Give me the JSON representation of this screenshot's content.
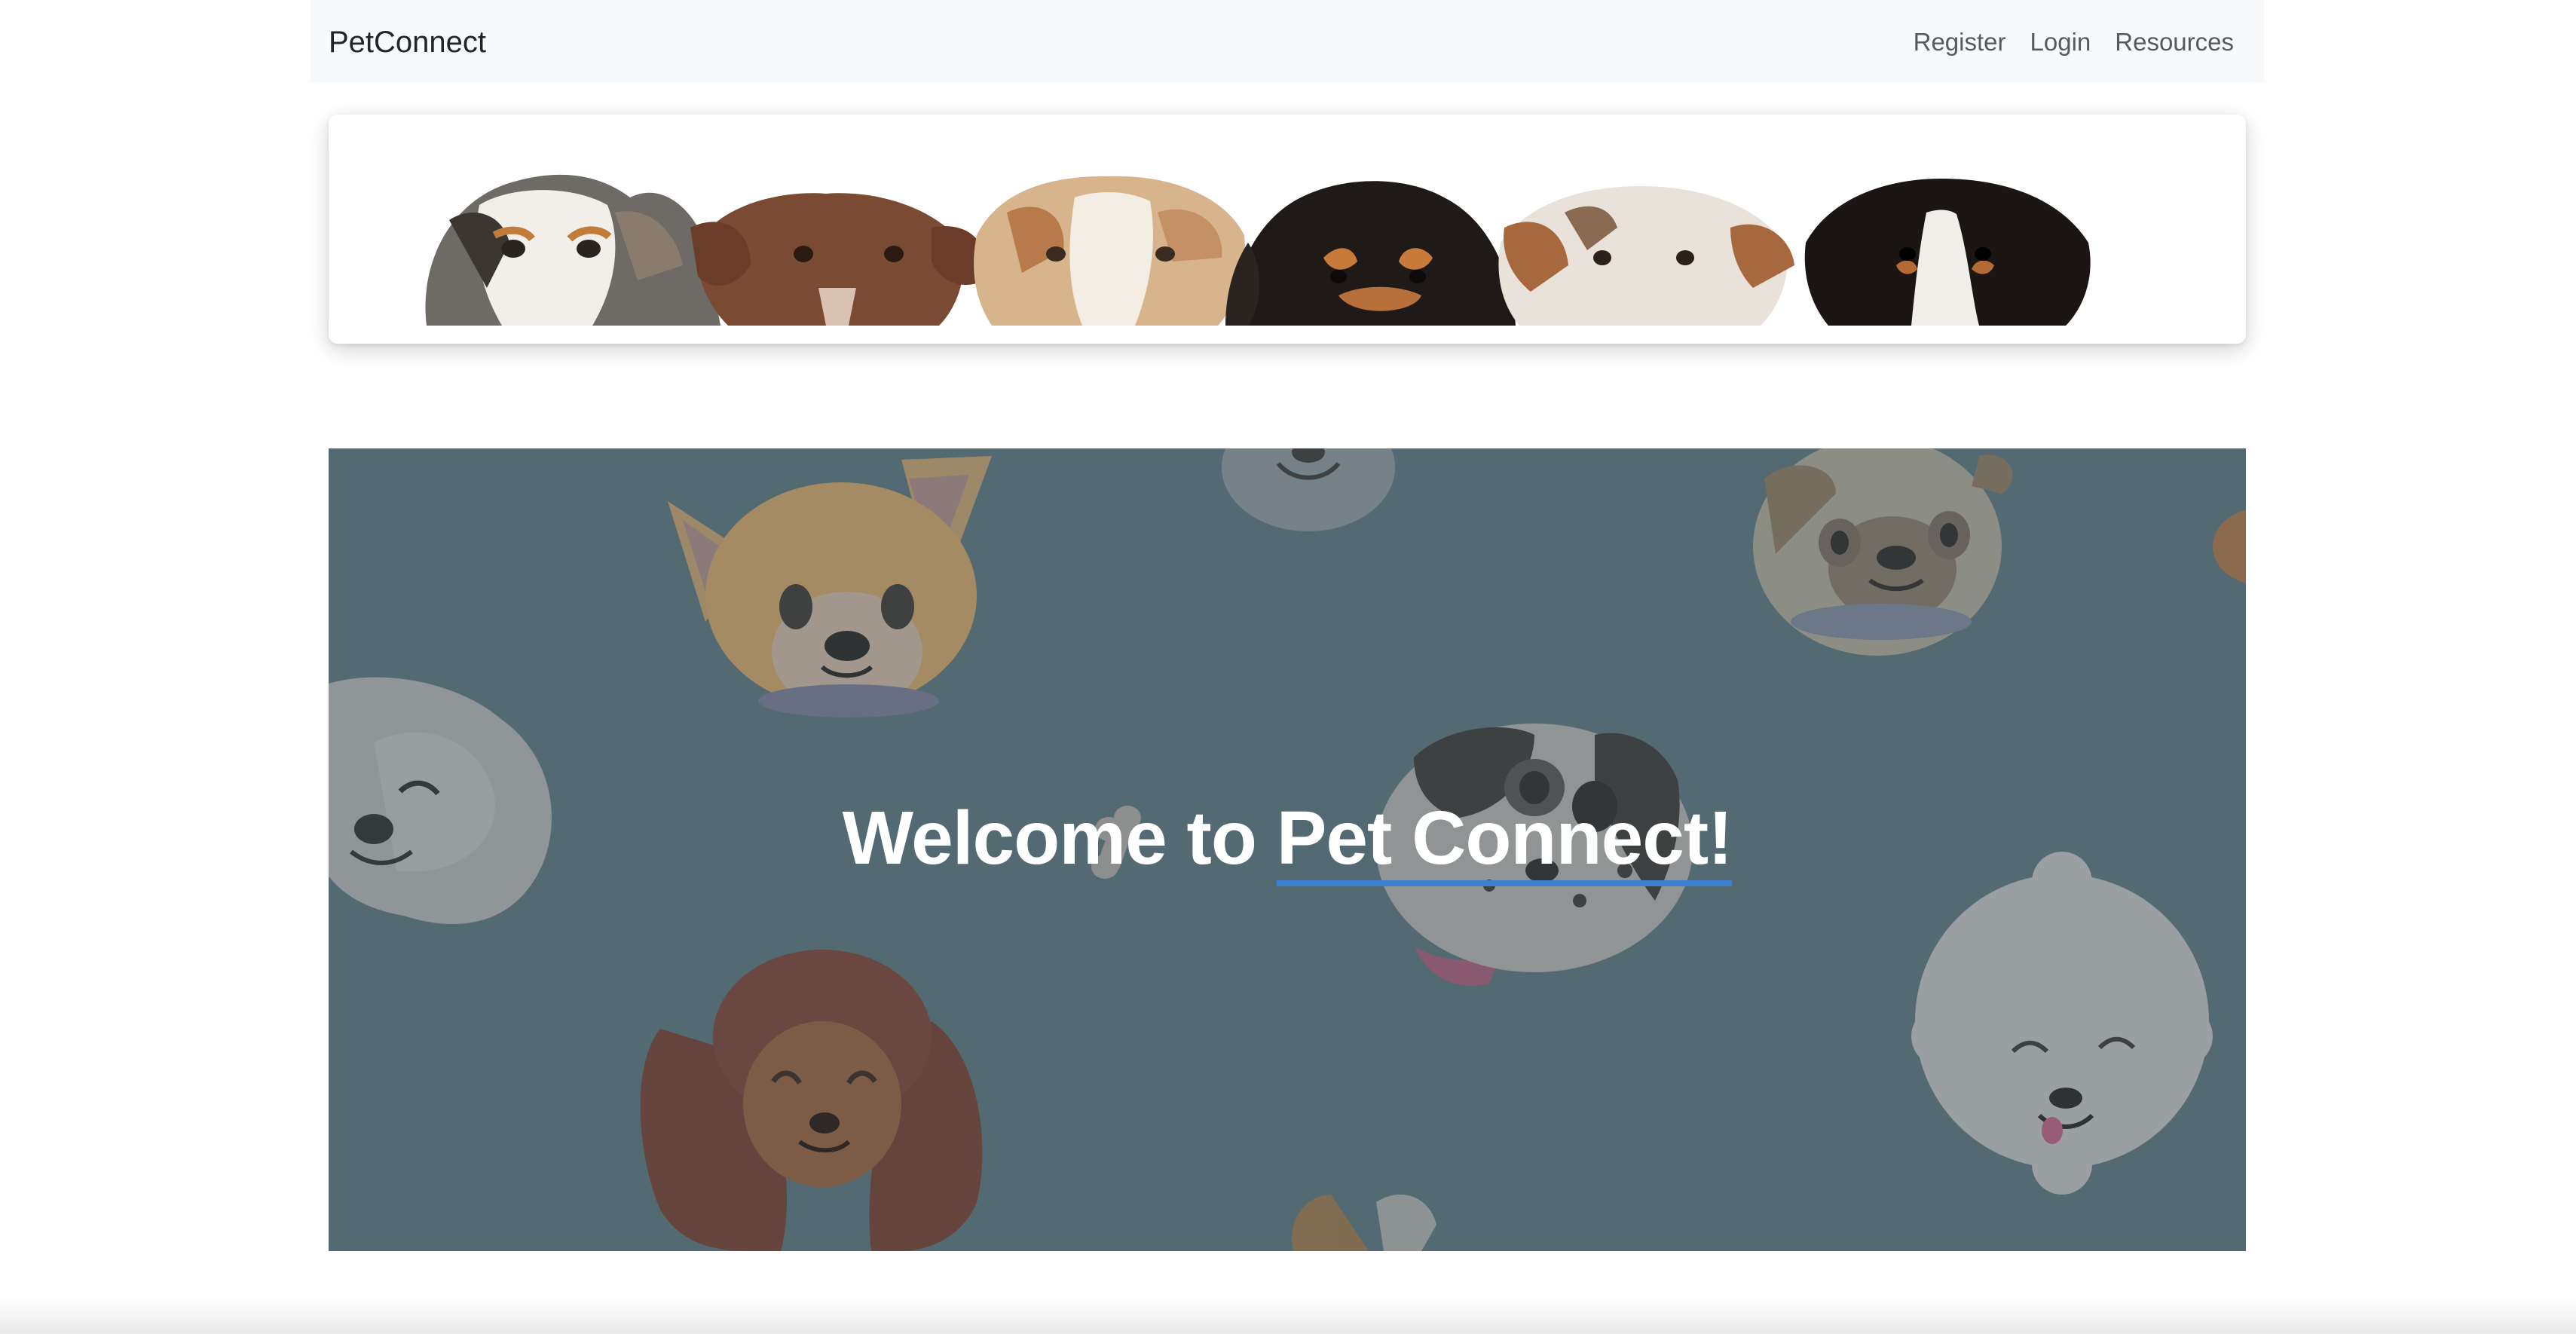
{
  "navbar": {
    "brand": "PetConnect",
    "links": [
      {
        "label": "Register"
      },
      {
        "label": "Login"
      },
      {
        "label": "Resources"
      }
    ]
  },
  "banner": {
    "dogs": [
      "merle-dog",
      "brown-dog",
      "red-merle-dog",
      "cavalier-dog",
      "terrier-dog",
      "tricolor-dog"
    ]
  },
  "hero": {
    "title_prefix": "Welcome to ",
    "title_highlight": "Pet Connect!",
    "background_color": "#546a72",
    "underline_color": "#3d7fd1"
  }
}
